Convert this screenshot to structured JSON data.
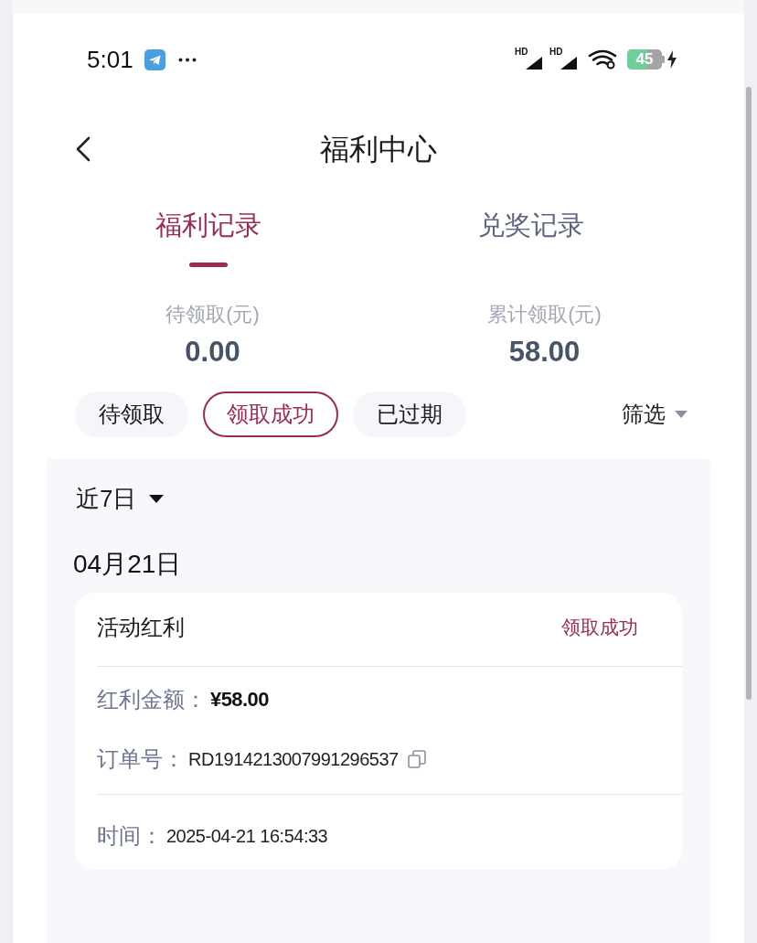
{
  "status_bar": {
    "time": "5:01",
    "signals": [
      {
        "label": "HD"
      },
      {
        "label": "HD"
      }
    ],
    "battery": "45"
  },
  "header": {
    "title": "福利中心"
  },
  "tabs": [
    {
      "label": "福利记录",
      "selected": true
    },
    {
      "label": "兑奖记录",
      "selected": false
    }
  ],
  "summary": [
    {
      "label": "待领取(元)",
      "value": "0.00"
    },
    {
      "label": "累计领取(元)",
      "value": "58.00"
    }
  ],
  "status_filters": [
    {
      "label": "待领取",
      "selected": false
    },
    {
      "label": "领取成功",
      "selected": true
    },
    {
      "label": "已过期",
      "selected": false
    }
  ],
  "filter_button": {
    "label": "筛选"
  },
  "period": {
    "label": "近7日"
  },
  "groups": [
    {
      "date": "04月21日",
      "records": [
        {
          "title": "活动红利",
          "status": "领取成功",
          "sections": [
            [
              {
                "kind": "amount",
                "label": "红利金额：",
                "value": "¥58.00"
              },
              {
                "kind": "copyable",
                "label": "订单号：",
                "value": "RD1914213007991296537"
              }
            ],
            [
              {
                "kind": "plain",
                "label": "时间：",
                "value": "2025-04-21 16:54:33"
              }
            ]
          ]
        }
      ]
    }
  ]
}
